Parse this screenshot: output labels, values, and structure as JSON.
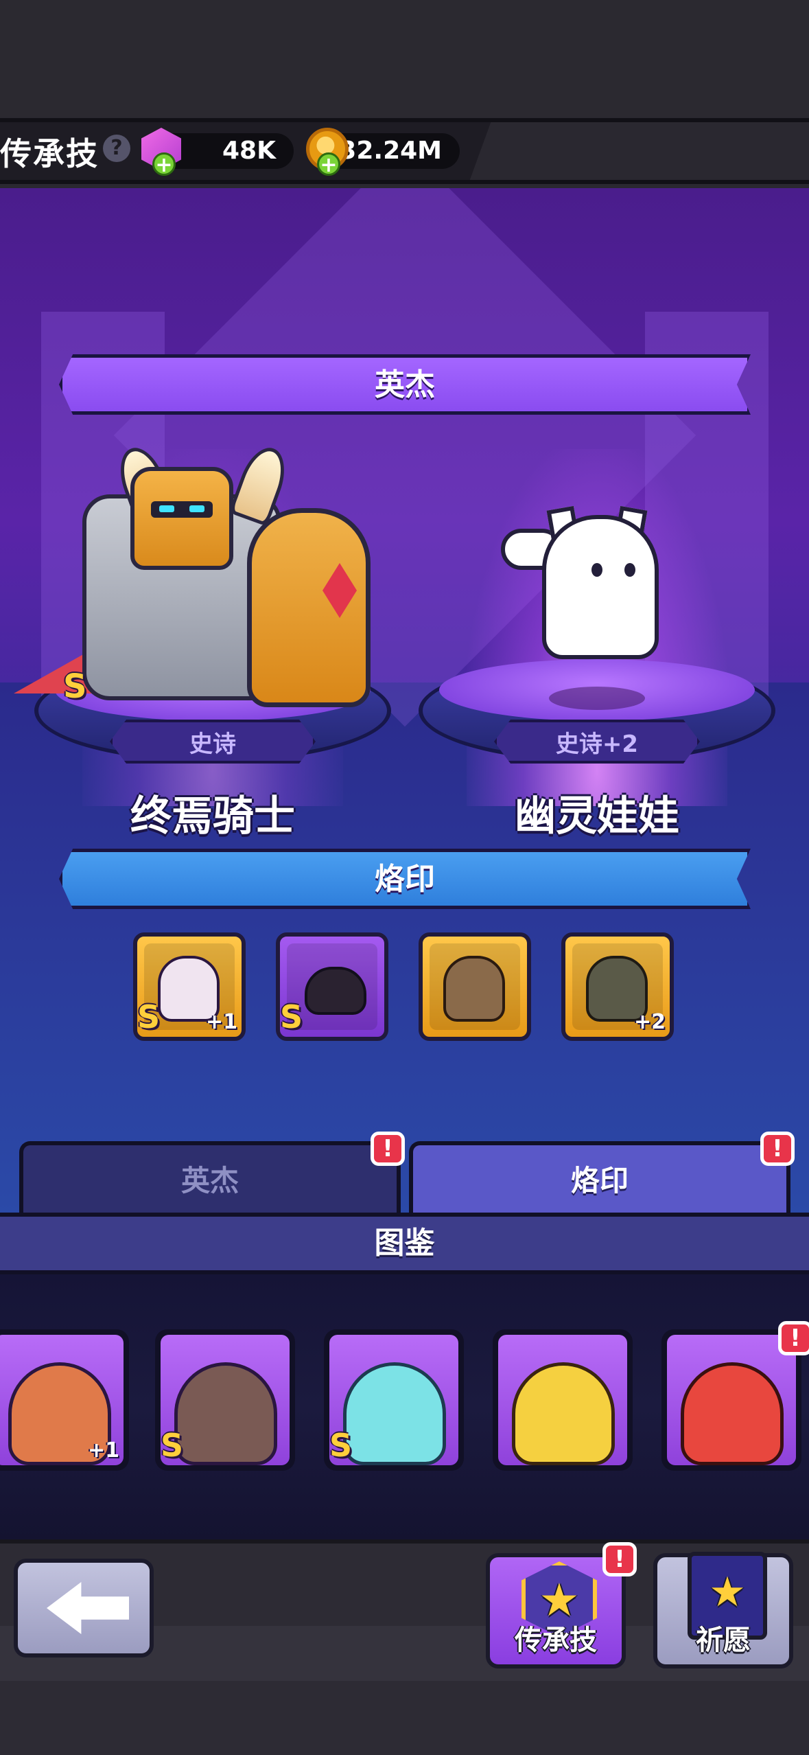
{
  "header": {
    "title": "传承技",
    "help_icon": "question-icon",
    "gems": "48K",
    "coins": "32.24M"
  },
  "hero_section": {
    "banner_label": "英杰",
    "left": {
      "rarity": "史诗",
      "name": "终焉骑士",
      "grade": "S"
    },
    "right": {
      "rarity": "史诗+2",
      "name": "幽灵娃娃"
    }
  },
  "imprint_section": {
    "banner_label": "烙印",
    "cards": [
      {
        "grade": "S",
        "plus": "+1",
        "color": "gold"
      },
      {
        "grade": "S",
        "plus": "",
        "color": "purple"
      },
      {
        "grade": "",
        "plus": "",
        "color": "gold"
      },
      {
        "grade": "",
        "plus": "+2",
        "color": "gold"
      }
    ]
  },
  "tabs": {
    "heroes": "英杰",
    "imprint": "烙印",
    "alert": "!"
  },
  "codex": {
    "label": "图鉴",
    "cards": [
      {
        "grade": "",
        "plus": "+1"
      },
      {
        "grade": "S",
        "plus": ""
      },
      {
        "grade": "S",
        "plus": ""
      },
      {
        "grade": "",
        "plus": ""
      },
      {
        "grade": "",
        "plus": ""
      }
    ]
  },
  "bottom_nav": {
    "legacy_label": "传承技",
    "wish_label": "祈愿",
    "alert": "!",
    "star": "★"
  },
  "colors": {
    "stage_top": "#4a1d8c",
    "banner_purple": "#a466ff",
    "banner_blue": "#4a9ef0",
    "alert_red": "#e8344a",
    "grade_gold": "#ffcf3b"
  }
}
